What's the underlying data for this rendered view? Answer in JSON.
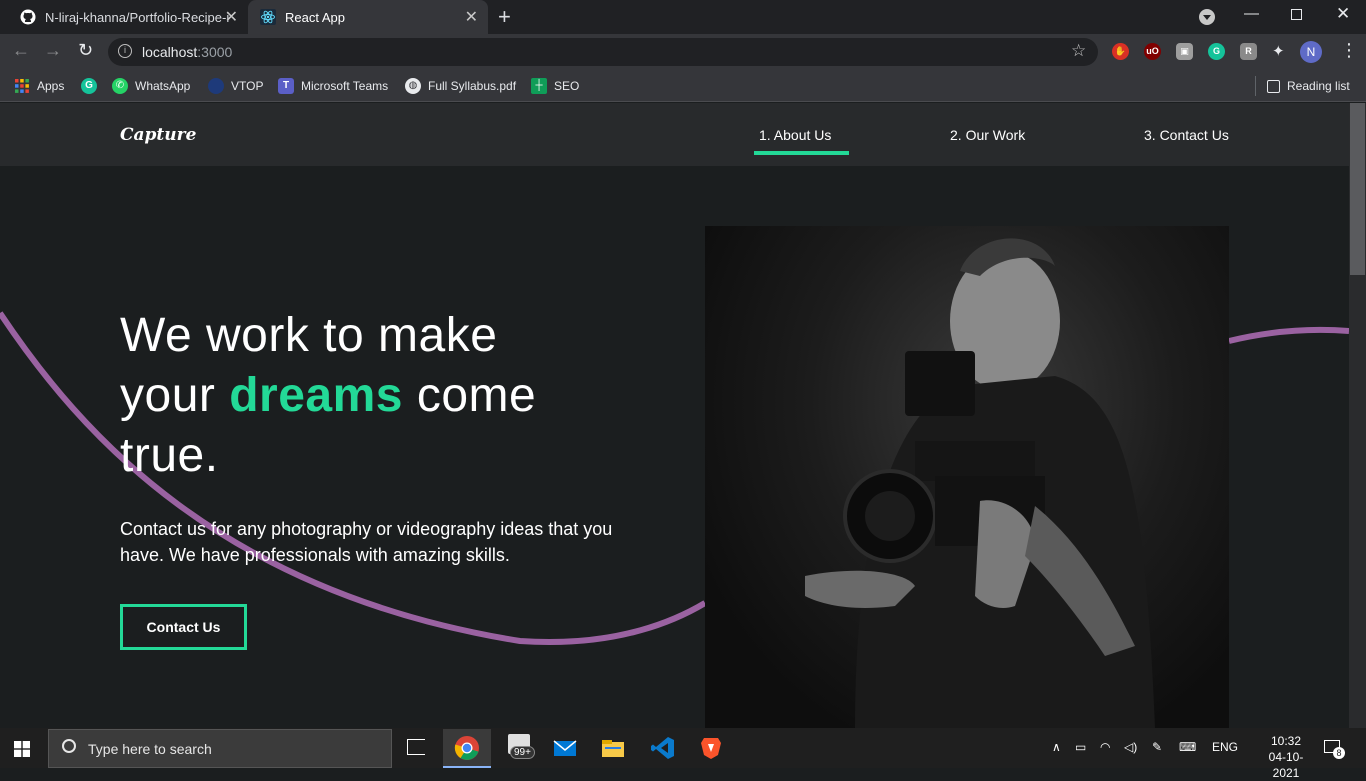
{
  "browser": {
    "tabs": [
      {
        "title": "N-liraj-khanna/Portfolio-Recipe-i",
        "icon": "github-icon"
      },
      {
        "title": "React App",
        "icon": "react-icon"
      }
    ],
    "url_host": "localhost",
    "url_port": ":3000",
    "profile_initial": "N",
    "bookmarks": [
      {
        "label": "Apps",
        "icon": "apps-grid-icon"
      },
      {
        "label": "",
        "icon": "grammarly-icon"
      },
      {
        "label": "WhatsApp",
        "icon": "whatsapp-icon"
      },
      {
        "label": "VTOP",
        "icon": "vtop-icon"
      },
      {
        "label": "Microsoft Teams",
        "icon": "teams-icon"
      },
      {
        "label": "Full Syllabus.pdf",
        "icon": "globe-icon"
      },
      {
        "label": "SEO",
        "icon": "sheets-icon"
      }
    ],
    "reading_list": "Reading list"
  },
  "site": {
    "logo": "Capture",
    "nav": [
      "1. About Us",
      "2. Our Work",
      "3. Contact Us"
    ],
    "hero": {
      "line1": "We work to make",
      "line2_pre": "your",
      "line2_highlight": "dreams",
      "line2_post": "come",
      "line3": "true.",
      "description": "Contact us for any photography or videography ideas that you have. We have professionals with amazing skills.",
      "cta": "Contact Us"
    },
    "accent_color": "#23d997",
    "wave_color": "#9a62a1"
  },
  "taskbar": {
    "search_placeholder": "Type here to search",
    "time": "10:32",
    "date": "04-10-2021",
    "language": "ENG",
    "badge_count": "99+",
    "notification_count": "8"
  }
}
